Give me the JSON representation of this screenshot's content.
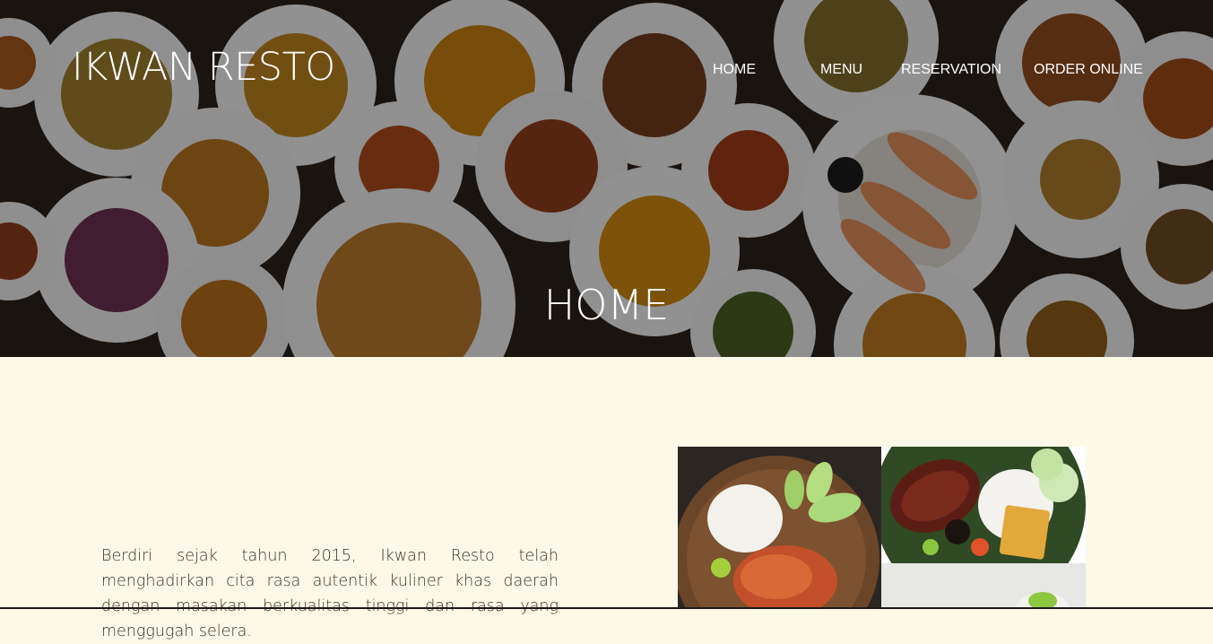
{
  "header": {
    "brand": "IKWAN RESTO",
    "nav": [
      {
        "label": "HOME"
      },
      {
        "label": "MENU"
      },
      {
        "label": "RESERVATION"
      },
      {
        "label": "ORDER ONLINE"
      }
    ]
  },
  "hero": {
    "title": "HOME"
  },
  "about": {
    "text": "Berdiri sejak tahun 2015, Ikwan Resto telah menghadirkan cita rasa autentik kuliner khas daerah dengan masakan berkualitas tinggi dan rasa yang menggugah selera."
  },
  "colors": {
    "page_background": "#fdf9e8",
    "text": "#3c3228",
    "overlay": "#000000"
  },
  "gallery": {
    "photos": [
      "ayam-geprek-plate-photo",
      "ikan-bakar-plate-photo",
      "salad-plate-photo"
    ]
  }
}
